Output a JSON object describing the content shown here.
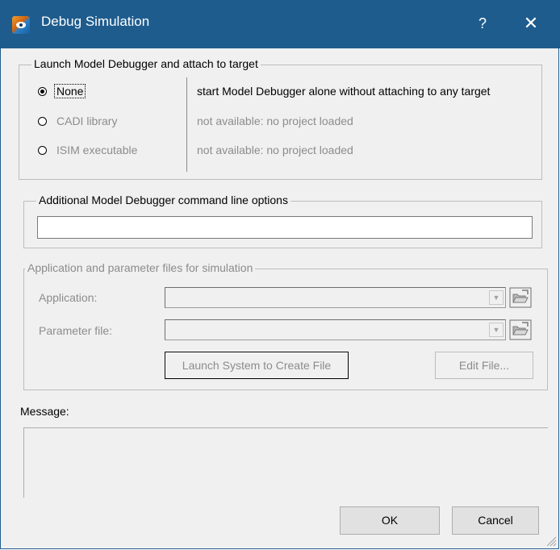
{
  "window": {
    "title": "Debug Simulation",
    "help": "?",
    "close": "✕"
  },
  "launch_group": {
    "title": "Launch Model Debugger and attach to target",
    "options": [
      {
        "label": "None",
        "description": "start Model Debugger alone without attaching to any target",
        "checked": true,
        "enabled": true
      },
      {
        "label": "CADI library",
        "description": "not available: no project loaded",
        "checked": false,
        "enabled": false
      },
      {
        "label": "ISIM executable",
        "description": "not available: no project loaded",
        "checked": false,
        "enabled": false
      }
    ]
  },
  "options_group": {
    "title": "Additional Model Debugger command line options",
    "value": ""
  },
  "files_group": {
    "title": "Application and parameter files for simulation",
    "application_label": "Application:",
    "application_value": "",
    "parameter_label": "Parameter file:",
    "parameter_value": "",
    "launch_button": "Launch System to Create File",
    "edit_button": "Edit File..."
  },
  "message": {
    "label": "Message:",
    "text": ""
  },
  "buttons": {
    "ok": "OK",
    "cancel": "Cancel"
  }
}
